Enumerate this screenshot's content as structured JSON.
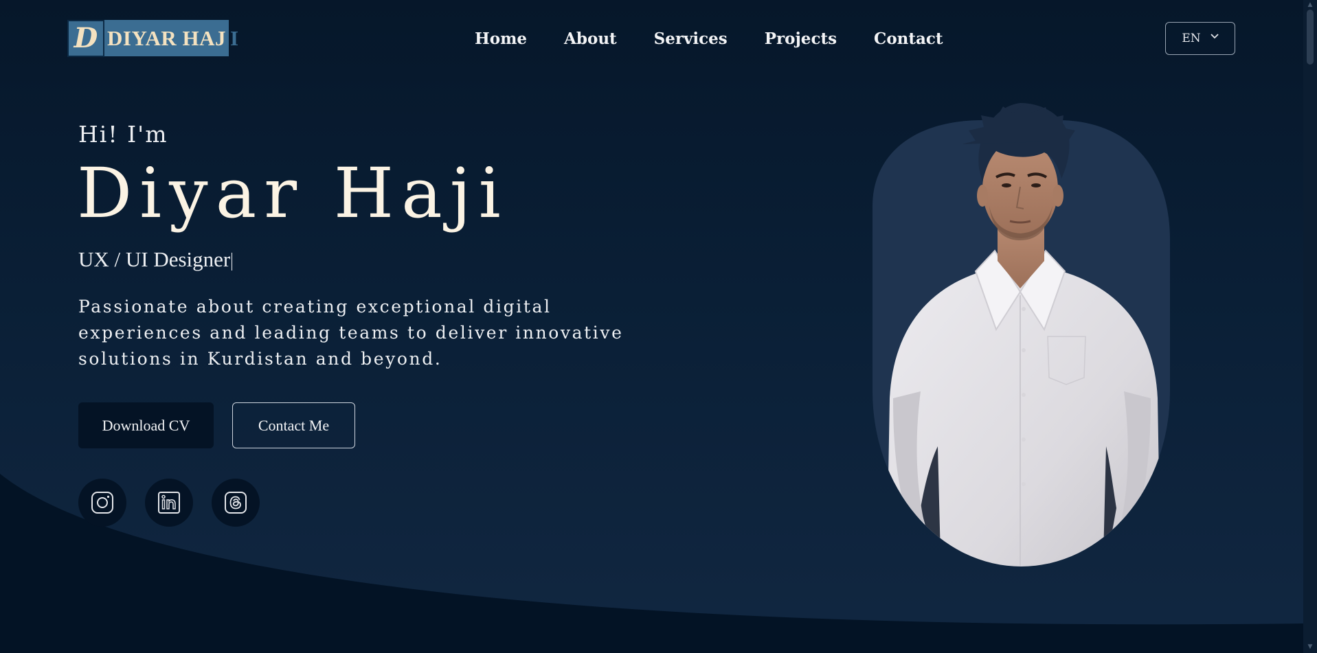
{
  "brand": {
    "logo_letter": "D",
    "name_highlighted": "DIYAR HAJ",
    "name_tail": "I"
  },
  "nav": {
    "items": [
      "Home",
      "About",
      "Services",
      "Projects",
      "Contact"
    ]
  },
  "language": {
    "selected": "EN"
  },
  "hero": {
    "greeting": "Hi! I'm",
    "name": "Diyar Haji",
    "role": "UX / UI Designer",
    "description": "Passionate about creating exceptional digital experiences and leading teams to deliver innovative solutions in Kurdistan and beyond.",
    "buttons": {
      "download_cv": "Download CV",
      "contact_me": "Contact Me"
    },
    "social": [
      "instagram-icon",
      "linkedin-icon",
      "threads-icon"
    ]
  },
  "colors": {
    "background": "#061628",
    "button_dark": "#041325",
    "logo_bg": "#3b6d92",
    "name_text": "#fbf3e4"
  }
}
